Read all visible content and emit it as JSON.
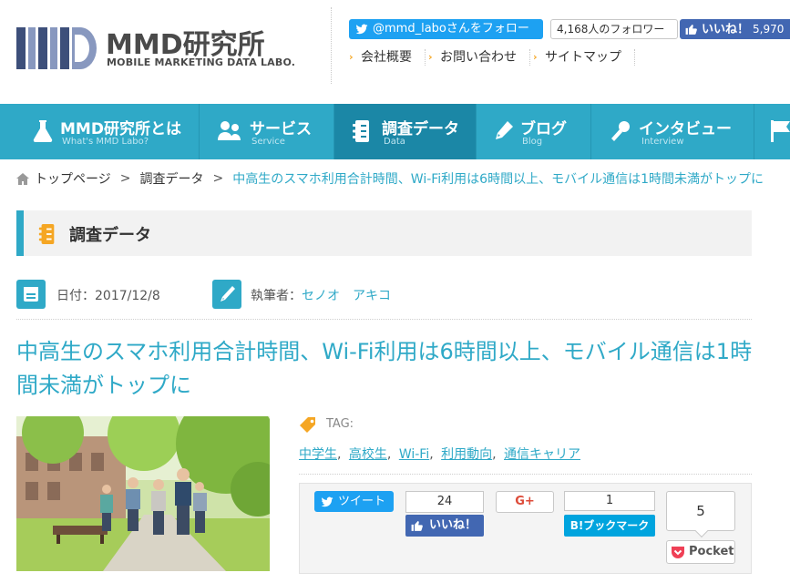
{
  "header": {
    "logo_name": "MMD研究所",
    "logo_sub": "MOBILE MARKETING DATA LABO.",
    "twitter_follow": "@mmd_laboさんをフォロー",
    "twitter_followers": "4,168人のフォロワー",
    "fb_like": "いいね！",
    "fb_count": "5,970",
    "links": [
      "会社概要",
      "お問い合わせ",
      "サイトマップ"
    ]
  },
  "nav": [
    {
      "label": "MMD研究所とは",
      "sub": "What's MMD Labo?"
    },
    {
      "label": "サービス",
      "sub": "Service"
    },
    {
      "label": "調査データ",
      "sub": "Data"
    },
    {
      "label": "ブログ",
      "sub": "Blog"
    },
    {
      "label": "インタビュー",
      "sub": "Interview"
    }
  ],
  "breadcrumb": {
    "home": "トップページ",
    "section": "調査データ",
    "current": "中高生のスマホ利用合計時間、Wi-Fi利用は6時間以上、モバイル通信は1時間未満がトップに"
  },
  "section_title": "調査データ",
  "meta": {
    "date_label": "日付：2017/12/8",
    "author_label": "執筆者：",
    "author_name": "セノオ　アキコ"
  },
  "article": {
    "title": "中高生のスマホ利用合計時間、Wi-Fi利用は6時間以上、モバイル通信は1時間未満がトップに",
    "tag_label": "TAG:",
    "tags": [
      "中学生",
      "高校生",
      "Wi-Fi",
      "利用動向",
      "通信キャリア"
    ]
  },
  "share": {
    "tweet": "ツイート",
    "fb_count": "24",
    "fb_like": "いいね！",
    "gplus": "G+",
    "hatena_count": "1",
    "hatena": "B!ブックマーク",
    "pocket_count": "5",
    "pocket": "Pocket"
  },
  "colors": {
    "accent": "#2fa9c7",
    "nav_active": "#1b87a6",
    "twitter": "#1da1f2",
    "facebook": "#4267b2",
    "hatena": "#00a4de",
    "pocket": "#ef4056",
    "tag_orange": "#f5a623"
  }
}
